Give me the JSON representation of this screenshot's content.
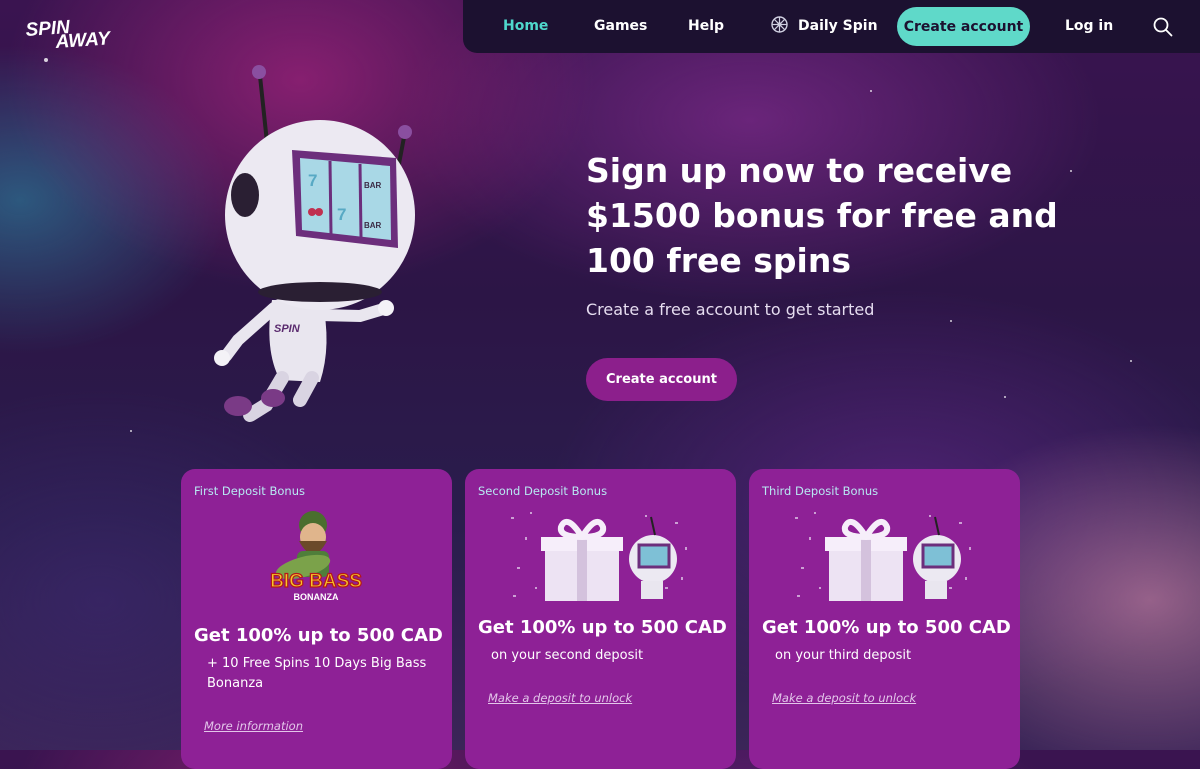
{
  "header": {
    "logo_text": "SPIN AWAY",
    "nav": {
      "home": "Home",
      "games": "Games",
      "help": "Help",
      "daily_spin": "Daily Spin",
      "create_account": "Create account",
      "log_in": "Log in"
    },
    "icons": {
      "daily_spin": "wheel-icon",
      "search": "search-icon"
    }
  },
  "hero": {
    "title": "Sign up now to receive $1500 bonus for free and 100 free spins",
    "subtitle": "Create a free account to get started",
    "cta": "Create account"
  },
  "cards": [
    {
      "label": "First Deposit Bonus",
      "image_text_1": "BIG BASS",
      "image_text_2": "BONANZA",
      "title": "Get 100% up to 500 CAD",
      "subtitle": "+ 10 Free Spins 10 Days Big Bass Bonanza",
      "link": "More information"
    },
    {
      "label": "Second Deposit Bonus",
      "title": "Get 100% up to 500 CAD",
      "subtitle": "on your second deposit",
      "link": "Make a deposit to unlock"
    },
    {
      "label": "Third Deposit Bonus",
      "title": "Get 100% up to 500 CAD",
      "subtitle": "on your third deposit",
      "link": "Make a deposit to unlock"
    }
  ],
  "colors": {
    "accent_teal": "#5fd9c9",
    "nav_bg": "#1c1130",
    "card_bg": "#8e2196",
    "cta_purple": "#8c1f8c"
  }
}
